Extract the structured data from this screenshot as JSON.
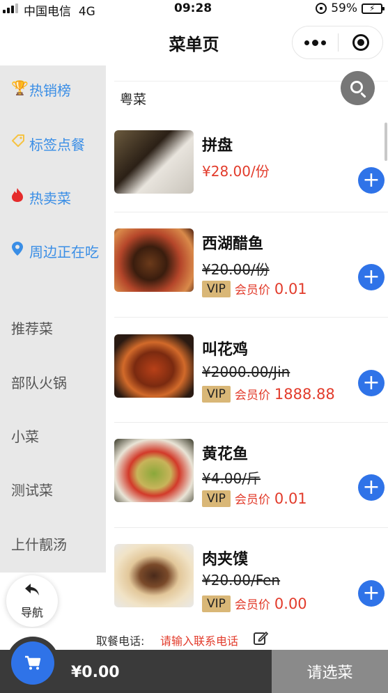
{
  "status_bar": {
    "carrier": "中国电信",
    "network": "4G",
    "time": "09:28",
    "battery": "59%",
    "battery_level": 0.59
  },
  "nav": {
    "title": "菜单页"
  },
  "sidebar": {
    "items": [
      {
        "label": "热销榜",
        "icon": "trophy-icon"
      },
      {
        "label": "标签点餐",
        "icon": "tag-icon"
      },
      {
        "label": "热卖菜",
        "icon": "fire-icon"
      },
      {
        "label": "周边正在吃",
        "icon": "location-pin-icon"
      },
      {
        "label": "推荐菜"
      },
      {
        "label": "部队火锅"
      },
      {
        "label": "小菜"
      },
      {
        "label": "测试菜"
      },
      {
        "label": "上什靓汤"
      }
    ],
    "nav_button_label": "导航"
  },
  "menu": {
    "section_title": "粤菜",
    "vip_badge": "VIP",
    "vip_label": "会员价",
    "items": [
      {
        "name": "拼盘",
        "price": "¥28.00/份"
      },
      {
        "name": "西湖醋鱼",
        "original_price": "¥20.00/份",
        "vip_price": "0.01"
      },
      {
        "name": "叫花鸡",
        "original_price": "¥2000.00/Jin",
        "vip_price": "1888.88"
      },
      {
        "name": "黄花鱼",
        "original_price": "¥4.00/斤",
        "vip_price": "0.01"
      },
      {
        "name": "肉夹馍",
        "original_price": "¥20.00/Fen",
        "vip_price": "0.00"
      }
    ]
  },
  "footer": {
    "phone_label": "取餐电话:",
    "phone_placeholder": "请输入联系电话",
    "total": "¥0.00",
    "checkout_label": "请选菜"
  },
  "colors": {
    "accent": "#2f73e8",
    "price": "#e23b2b",
    "vip_badge": "#d9b777",
    "sidebar_bg": "#e8e8e8",
    "bottom_bar": "#3a3a3a",
    "checkout": "#8a8a8a"
  }
}
